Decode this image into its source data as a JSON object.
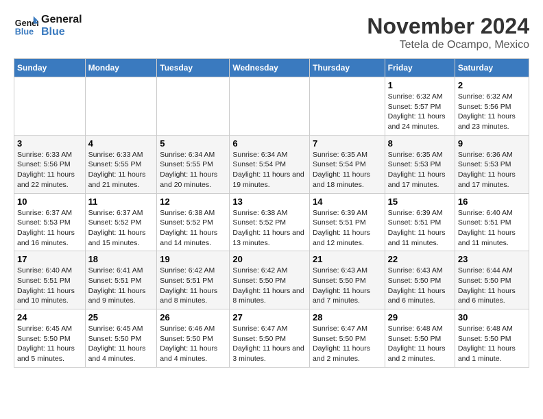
{
  "logo": {
    "text_general": "General",
    "text_blue": "Blue"
  },
  "header": {
    "month": "November 2024",
    "location": "Tetela de Ocampo, Mexico"
  },
  "weekdays": [
    "Sunday",
    "Monday",
    "Tuesday",
    "Wednesday",
    "Thursday",
    "Friday",
    "Saturday"
  ],
  "weeks": [
    [
      {
        "day": "",
        "info": ""
      },
      {
        "day": "",
        "info": ""
      },
      {
        "day": "",
        "info": ""
      },
      {
        "day": "",
        "info": ""
      },
      {
        "day": "",
        "info": ""
      },
      {
        "day": "1",
        "info": "Sunrise: 6:32 AM\nSunset: 5:57 PM\nDaylight: 11 hours and 24 minutes."
      },
      {
        "day": "2",
        "info": "Sunrise: 6:32 AM\nSunset: 5:56 PM\nDaylight: 11 hours and 23 minutes."
      }
    ],
    [
      {
        "day": "3",
        "info": "Sunrise: 6:33 AM\nSunset: 5:56 PM\nDaylight: 11 hours and 22 minutes."
      },
      {
        "day": "4",
        "info": "Sunrise: 6:33 AM\nSunset: 5:55 PM\nDaylight: 11 hours and 21 minutes."
      },
      {
        "day": "5",
        "info": "Sunrise: 6:34 AM\nSunset: 5:55 PM\nDaylight: 11 hours and 20 minutes."
      },
      {
        "day": "6",
        "info": "Sunrise: 6:34 AM\nSunset: 5:54 PM\nDaylight: 11 hours and 19 minutes."
      },
      {
        "day": "7",
        "info": "Sunrise: 6:35 AM\nSunset: 5:54 PM\nDaylight: 11 hours and 18 minutes."
      },
      {
        "day": "8",
        "info": "Sunrise: 6:35 AM\nSunset: 5:53 PM\nDaylight: 11 hours and 17 minutes."
      },
      {
        "day": "9",
        "info": "Sunrise: 6:36 AM\nSunset: 5:53 PM\nDaylight: 11 hours and 17 minutes."
      }
    ],
    [
      {
        "day": "10",
        "info": "Sunrise: 6:37 AM\nSunset: 5:53 PM\nDaylight: 11 hours and 16 minutes."
      },
      {
        "day": "11",
        "info": "Sunrise: 6:37 AM\nSunset: 5:52 PM\nDaylight: 11 hours and 15 minutes."
      },
      {
        "day": "12",
        "info": "Sunrise: 6:38 AM\nSunset: 5:52 PM\nDaylight: 11 hours and 14 minutes."
      },
      {
        "day": "13",
        "info": "Sunrise: 6:38 AM\nSunset: 5:52 PM\nDaylight: 11 hours and 13 minutes."
      },
      {
        "day": "14",
        "info": "Sunrise: 6:39 AM\nSunset: 5:51 PM\nDaylight: 11 hours and 12 minutes."
      },
      {
        "day": "15",
        "info": "Sunrise: 6:39 AM\nSunset: 5:51 PM\nDaylight: 11 hours and 11 minutes."
      },
      {
        "day": "16",
        "info": "Sunrise: 6:40 AM\nSunset: 5:51 PM\nDaylight: 11 hours and 11 minutes."
      }
    ],
    [
      {
        "day": "17",
        "info": "Sunrise: 6:40 AM\nSunset: 5:51 PM\nDaylight: 11 hours and 10 minutes."
      },
      {
        "day": "18",
        "info": "Sunrise: 6:41 AM\nSunset: 5:51 PM\nDaylight: 11 hours and 9 minutes."
      },
      {
        "day": "19",
        "info": "Sunrise: 6:42 AM\nSunset: 5:51 PM\nDaylight: 11 hours and 8 minutes."
      },
      {
        "day": "20",
        "info": "Sunrise: 6:42 AM\nSunset: 5:50 PM\nDaylight: 11 hours and 8 minutes."
      },
      {
        "day": "21",
        "info": "Sunrise: 6:43 AM\nSunset: 5:50 PM\nDaylight: 11 hours and 7 minutes."
      },
      {
        "day": "22",
        "info": "Sunrise: 6:43 AM\nSunset: 5:50 PM\nDaylight: 11 hours and 6 minutes."
      },
      {
        "day": "23",
        "info": "Sunrise: 6:44 AM\nSunset: 5:50 PM\nDaylight: 11 hours and 6 minutes."
      }
    ],
    [
      {
        "day": "24",
        "info": "Sunrise: 6:45 AM\nSunset: 5:50 PM\nDaylight: 11 hours and 5 minutes."
      },
      {
        "day": "25",
        "info": "Sunrise: 6:45 AM\nSunset: 5:50 PM\nDaylight: 11 hours and 4 minutes."
      },
      {
        "day": "26",
        "info": "Sunrise: 6:46 AM\nSunset: 5:50 PM\nDaylight: 11 hours and 4 minutes."
      },
      {
        "day": "27",
        "info": "Sunrise: 6:47 AM\nSunset: 5:50 PM\nDaylight: 11 hours and 3 minutes."
      },
      {
        "day": "28",
        "info": "Sunrise: 6:47 AM\nSunset: 5:50 PM\nDaylight: 11 hours and 2 minutes."
      },
      {
        "day": "29",
        "info": "Sunrise: 6:48 AM\nSunset: 5:50 PM\nDaylight: 11 hours and 2 minutes."
      },
      {
        "day": "30",
        "info": "Sunrise: 6:48 AM\nSunset: 5:50 PM\nDaylight: 11 hours and 1 minute."
      }
    ]
  ]
}
